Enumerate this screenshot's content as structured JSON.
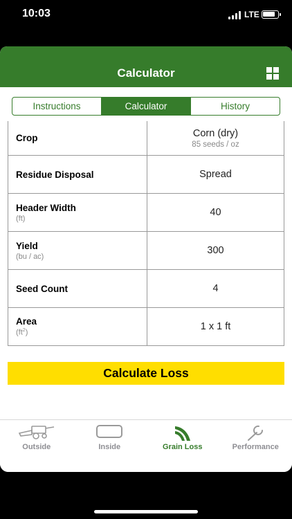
{
  "status_bar": {
    "time": "10:03",
    "network": "LTE"
  },
  "header": {
    "title": "Calculator"
  },
  "tabs": [
    {
      "label": "Instructions",
      "active": false
    },
    {
      "label": "Calculator",
      "active": true
    },
    {
      "label": "History",
      "active": false
    }
  ],
  "rows": [
    {
      "label": "Crop",
      "unit": "",
      "value": "Corn (dry)",
      "sub": "85 seeds / oz"
    },
    {
      "label": "Residue Disposal",
      "unit": "",
      "value": "Spread",
      "sub": ""
    },
    {
      "label": "Header Width",
      "unit": "(ft)",
      "value": "40",
      "sub": ""
    },
    {
      "label": "Yield",
      "unit": "(bu / ac)",
      "value": "300",
      "sub": ""
    },
    {
      "label": "Seed Count",
      "unit": "",
      "value": "4",
      "sub": ""
    },
    {
      "label": "Area",
      "unit": "(ft",
      "unit_sup": "2",
      "unit_end": ")",
      "value": "1 x 1 ft",
      "sub": ""
    }
  ],
  "calculate_button": "Calculate Loss",
  "bottom_nav": [
    {
      "label": "Outside",
      "icon": "combine-icon",
      "active": false
    },
    {
      "label": "Inside",
      "icon": "screen-icon",
      "active": false
    },
    {
      "label": "Grain Loss",
      "icon": "grain-loss-icon",
      "active": true
    },
    {
      "label": "Performance",
      "icon": "wrench-icon",
      "active": false
    }
  ],
  "colors": {
    "brand_green": "#367c2b",
    "accent_yellow": "#ffde00"
  }
}
